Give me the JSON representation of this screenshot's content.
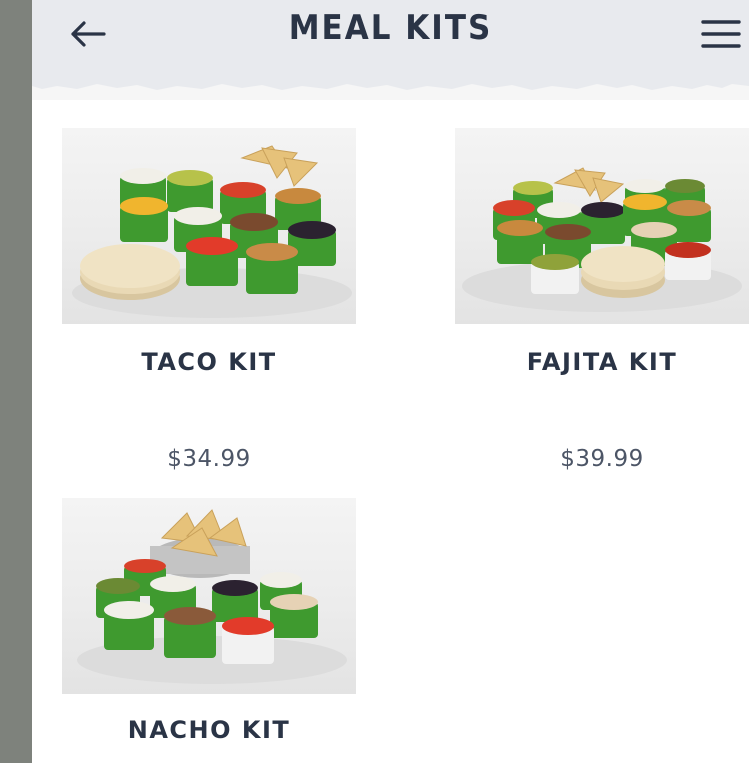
{
  "header": {
    "title": "MEAL KITS",
    "back_icon": "arrow-left-icon",
    "menu_icon": "hamburger-menu-icon",
    "background": "#e8eaee",
    "text_color": "#2a3446"
  },
  "kits": [
    {
      "name": "TACO KIT",
      "price": "$34.99"
    },
    {
      "name": "FAJITA KIT",
      "price": "$39.99"
    },
    {
      "name": "NACHO KIT",
      "price": ""
    }
  ],
  "colors": {
    "tub_green": "#3f9a2f",
    "tortilla": "#e9d9b5",
    "chips": "#e6c27a"
  }
}
